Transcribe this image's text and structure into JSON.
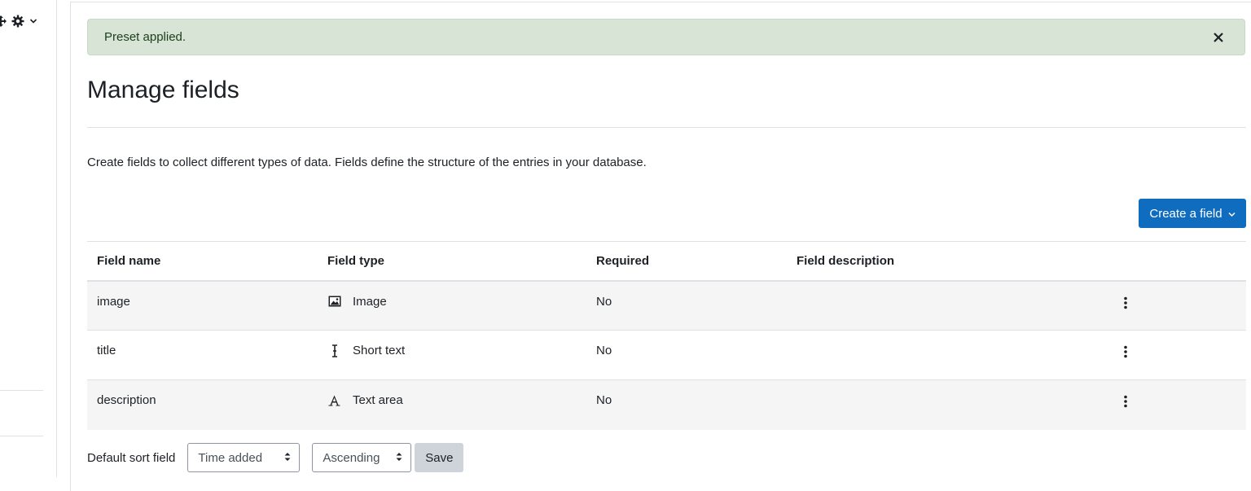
{
  "sidebar": {
    "icons": [
      "move-icon",
      "gear-icon",
      "chevron-down-icon"
    ]
  },
  "alert": {
    "message": "Preset applied.",
    "close_icon": "close-icon"
  },
  "page": {
    "title": "Manage fields",
    "intro": "Create fields to collect different types of data. Fields define the structure of the entries in your database."
  },
  "actions": {
    "create_label": "Create a field",
    "create_icon": "chevron-down-icon",
    "primary_color": "#0f6cbf"
  },
  "table": {
    "headers": [
      "Field name",
      "Field type",
      "Required",
      "Field description"
    ],
    "rows": [
      {
        "name": "image",
        "type": "Image",
        "type_icon": "image-icon",
        "required": "No",
        "description": ""
      },
      {
        "name": "title",
        "type": "Short text",
        "type_icon": "text-cursor-icon",
        "required": "No",
        "description": ""
      },
      {
        "name": "description",
        "type": "Text area",
        "type_icon": "font-icon",
        "required": "No",
        "description": ""
      }
    ]
  },
  "sort": {
    "label": "Default sort field",
    "field_value": "Time added",
    "order_value": "Ascending",
    "save_label": "Save"
  },
  "colors": {
    "alert_background": "#d7e4d6",
    "alert_text": "#1c3f1a"
  }
}
